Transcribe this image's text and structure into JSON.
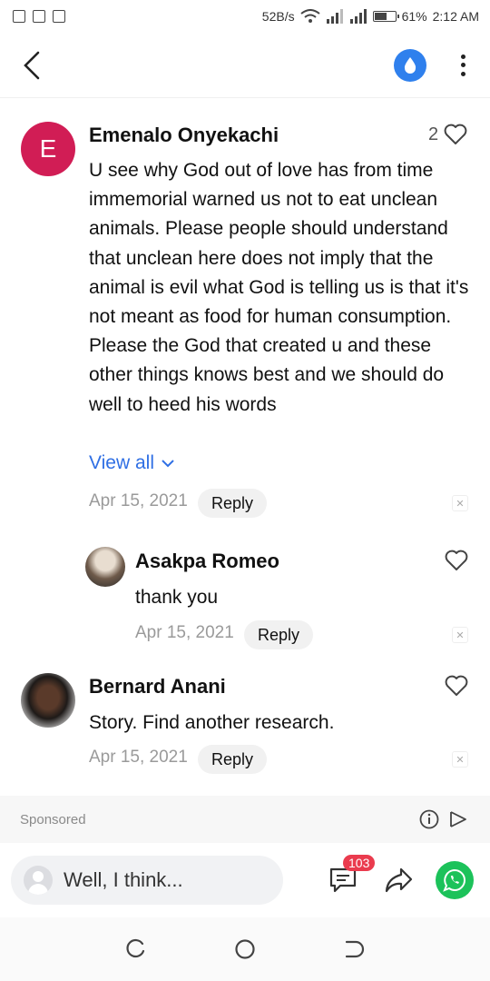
{
  "status_bar": {
    "speed": "52B/s",
    "battery": "61%",
    "time": "2:12 AM",
    "battery_level": 0.61
  },
  "comments": [
    {
      "author": "Emenalo Onyekachi",
      "avatar_letter": "E",
      "text": "U see why God out of love has from time immemorial warned us not to eat unclean animals. Please people should understand that unclean here does not imply that the animal is evil what God is telling us is that it's not meant as food for human consumption. Please the God that created u and these other things knows best and we should do well to heed his words",
      "likes": "2",
      "view_all": "View all",
      "date": "Apr 15, 2021",
      "reply": "Reply"
    },
    {
      "author": "Asakpa Romeo",
      "text": "thank you",
      "date": "Apr 15, 2021",
      "reply": "Reply"
    },
    {
      "author": "Bernard Anani",
      "text": "Story. Find another research.",
      "date": "Apr 15, 2021",
      "reply": "Reply"
    }
  ],
  "sponsored": {
    "label": "Sponsored"
  },
  "input": {
    "placeholder": "Well, I think..."
  },
  "comments_count": "103",
  "colors": {
    "accent": "#2f80ed",
    "avatar_e": "#d11d55",
    "whatsapp": "#1cc25a",
    "badge": "#ea3b4e",
    "link": "#2f6fe4"
  }
}
